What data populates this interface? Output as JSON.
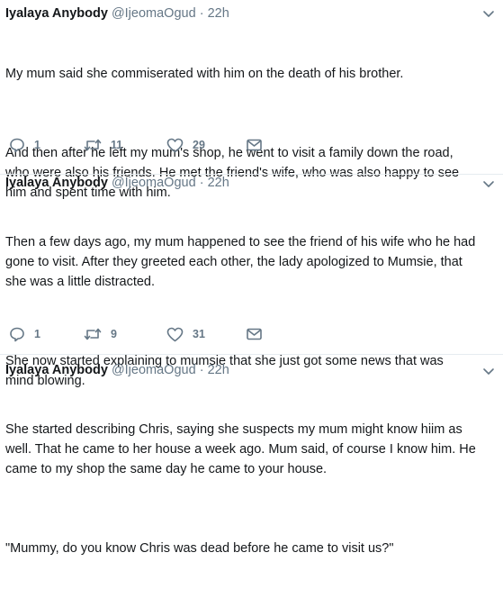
{
  "tweets": [
    {
      "name": "Iyalaya Anybody",
      "handle": "@IjeomaOgud",
      "separator": "·",
      "time": "22h",
      "paragraphs": [
        "My mum said she commiserated with him on the death of his brother.",
        "And then after he left my mum's shop, he went to visit a family down the road,\nwho were also his friends. He met the friend's wife, who was also happy to see\nhim and spent time with him."
      ],
      "replies": "1",
      "retweets": "11",
      "likes": "29"
    },
    {
      "name": "Iyalaya Anybody",
      "handle": "@IjeomaOgud",
      "separator": "·",
      "time": "22h",
      "paragraphs": [
        "Then a few days ago, my mum happened to see the friend of his wife who he had\ngone to visit. After they greeted each other, the lady apologized to Mumsie, that\nshe was a little distracted.",
        "She now started explaining to mumsie that she just got some news that was\nmind blowing."
      ],
      "replies": "1",
      "retweets": "9",
      "likes": "31"
    },
    {
      "name": "Iyalaya Anybody",
      "handle": "@IjeomaOgud",
      "separator": "·",
      "time": "22h",
      "paragraphs": [
        "She started describing Chris, saying she suspects my mum might know hiim as\nwell. That he came to her house a week ago. Mum said, of course I know him. He\ncame to my shop the same day he came to your house.",
        "\"Mummy, do you know Chris was dead before he came to visit us?\""
      ]
    }
  ],
  "icons": {
    "reply": "reply-icon",
    "retweet": "retweet-icon",
    "like": "heart-icon",
    "dm": "envelope-icon",
    "menu": "chevron-down-icon"
  },
  "colors": {
    "text": "#14171a",
    "secondary": "#657786",
    "divider": "#e6ecf0"
  }
}
